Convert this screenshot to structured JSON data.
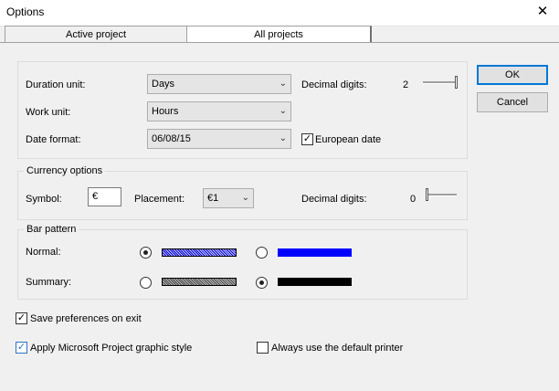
{
  "window": {
    "title": "Options",
    "close_glyph": "✕"
  },
  "tabs": [
    {
      "label": "Active project",
      "selected": false
    },
    {
      "label": "All projects",
      "selected": true
    }
  ],
  "buttons": {
    "ok": "OK",
    "cancel": "Cancel"
  },
  "units": {
    "duration_label": "Duration unit:",
    "duration_value": "Days",
    "work_label": "Work unit:",
    "work_value": "Hours",
    "date_label": "Date format:",
    "date_value": "06/08/15",
    "decimal_label": "Decimal digits:",
    "decimal_value": "2",
    "european_label": "European date",
    "european_checked": true
  },
  "currency": {
    "group_title": "Currency options",
    "symbol_label": "Symbol:",
    "symbol_value": "€",
    "placement_label": "Placement:",
    "placement_value": "€1",
    "decimal_label": "Decimal digits:",
    "decimal_value": "0"
  },
  "bar_pattern": {
    "group_title": "Bar pattern",
    "normal_label": "Normal:",
    "summary_label": "Summary:",
    "normal_selected": "pattern",
    "summary_selected": "solid",
    "colors": {
      "normal_solid": "#0000ff",
      "summary_solid": "#000000",
      "normal_hatch": "#0000cc",
      "summary_hatch": "#444444"
    }
  },
  "options": {
    "save_prefs_label": "Save preferences on exit",
    "save_prefs_checked": true,
    "ms_style_label": "Apply Microsoft Project graphic style",
    "ms_style_checked": true,
    "default_printer_label": "Always use the default printer",
    "default_printer_checked": false
  },
  "icons": {
    "chevron": "chevron-down-icon",
    "check": "checkmark-icon",
    "close": "close-icon"
  }
}
